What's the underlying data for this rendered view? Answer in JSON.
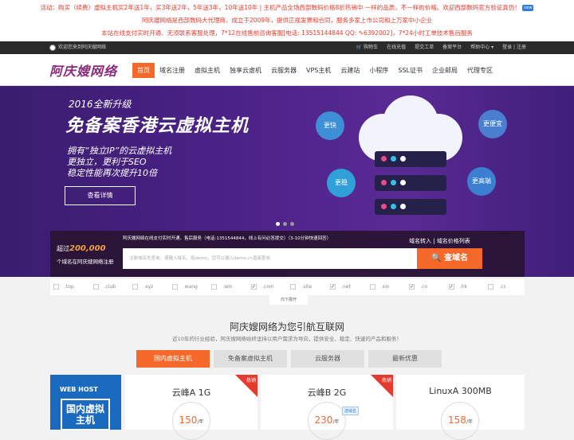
{
  "promo": {
    "line1": "活动：购买（续费）虚拟主机买2年送1年，买3年送2年，5年送3年，10年送10年 | 主机产品全场西部数码价格8折热销中 一样的品质，不一样的价格。欢迎西部数码官方验证真伪！",
    "new_badge": "new",
    "line2": "阿庆嫂网络是西部数码大代理商，成立于2009年，提供正规发票和合同，服务多家上市公司和上万家中小企业",
    "line3": "本站在线支付实时开通、无须联系客服处理，7*12在线售前咨询客服[电话: 13515144844 QQ: ",
    "line3_qq": "6392002]，7*24小时工单技术售后服务"
  },
  "topbar": {
    "welcome": "欢迎您来到阿庆嫂网络",
    "links": [
      "购物车",
      "在线充值",
      "提交工单",
      "备案平台",
      "帮助中心",
      "登录",
      "注册"
    ]
  },
  "nav": {
    "logo": "阿庆嫂网络",
    "items": [
      "首页",
      "域名注册",
      "虚拟主机",
      "独享云虚机",
      "云服务器",
      "VPS主机",
      "云建站",
      "小程序",
      "SSL证书",
      "企业邮局",
      "代理专区"
    ]
  },
  "banner": {
    "year_tag": "2016全新升级",
    "headline": "免备案香港云虚拟主机",
    "feature1": "拥有“独立IP”的云虚拟主机",
    "feature2": "更独立，更利于SEO",
    "feature3": "稳定性能再次提升10倍",
    "detail_button": "查看详情",
    "bubbles": [
      "更快",
      "更便宜",
      "更稳",
      "更高端"
    ]
  },
  "domain_search": {
    "count_prefix": "超过",
    "count": "200,000",
    "count_suffix": "个域名在阿庆嫂网络注册",
    "tip": "阿庆嫂网络在线支付实时开通，售后服务（电话:1351544844，线上有问必答提交）（3-10分钟快速回答）",
    "link1": "域名转入",
    "link2": "域名价格列表",
    "placeholder": "注册域名先查询，请输入域名，如demo，您可以输入demo.cn直接查询",
    "button": "查域名"
  },
  "tlds": [
    {
      "name": ".top",
      "checked": false
    },
    {
      "name": ".club",
      "checked": false
    },
    {
      "name": ".xyz",
      "checked": false
    },
    {
      "name": ".wang",
      "checked": false
    },
    {
      "name": ".win",
      "checked": false
    },
    {
      "name": ".com",
      "checked": true
    },
    {
      "name": ".site",
      "checked": false
    },
    {
      "name": ".net",
      "checked": true
    },
    {
      "name": ".xin",
      "checked": false
    },
    {
      "name": ".cn",
      "checked": true
    },
    {
      "name": ".hk",
      "checked": true
    },
    {
      "name": ".cc",
      "checked": false
    }
  ],
  "expand_label": "向下展开",
  "section": {
    "title": "阿庆嫂网络为您引航互联网",
    "subtitle": "近10年的行业经验，阿庆嫂网络始终坚持以用户需求为导向，提供安全、稳定、快速的产品和服务！",
    "tabs": [
      "国内虚拟主机",
      "免备案虚拟主机",
      "云服务器",
      "最新优惠"
    ]
  },
  "webhost": {
    "title": "WEB HOST",
    "label": "国内虚拟主机"
  },
  "products": [
    {
      "name": "云峰A 1G",
      "price": "150",
      "unit": "/年",
      "hot": true,
      "tag": ""
    },
    {
      "name": "云峰B 2G",
      "price": "230",
      "unit": "/年",
      "hot": true,
      "tag": "送域名"
    },
    {
      "name": "LinuxA 300MB",
      "price": "158",
      "unit": "/年",
      "hot": false,
      "tag": ""
    }
  ],
  "hot_label": "热销",
  "colors": {
    "accent": "#f4692a",
    "promo_red": "#e63a2e",
    "banner_purple": "#4b2288",
    "web_host_blue": "#1a6ac0"
  }
}
